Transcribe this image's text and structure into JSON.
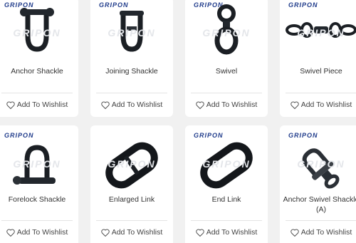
{
  "brand": "GRIPON",
  "watermark": "GRIPON",
  "wishlist_label": "Add To Wishlist",
  "products": [
    {
      "title": "Anchor Shackle",
      "icon": "anchor-shackle-icon"
    },
    {
      "title": "Joining Shackle",
      "icon": "joining-shackle-icon"
    },
    {
      "title": "Swivel",
      "icon": "swivel-icon"
    },
    {
      "title": "Swivel Piece",
      "icon": "swivel-piece-icon"
    },
    {
      "title": "Forelock Shackle",
      "icon": "forelock-shackle-icon"
    },
    {
      "title": "Enlarged Link",
      "icon": "enlarged-link-icon"
    },
    {
      "title": "End Link",
      "icon": "end-link-icon"
    },
    {
      "title": "Anchor Swivel Shackle (A)",
      "icon": "anchor-swivel-shackle-icon"
    }
  ]
}
